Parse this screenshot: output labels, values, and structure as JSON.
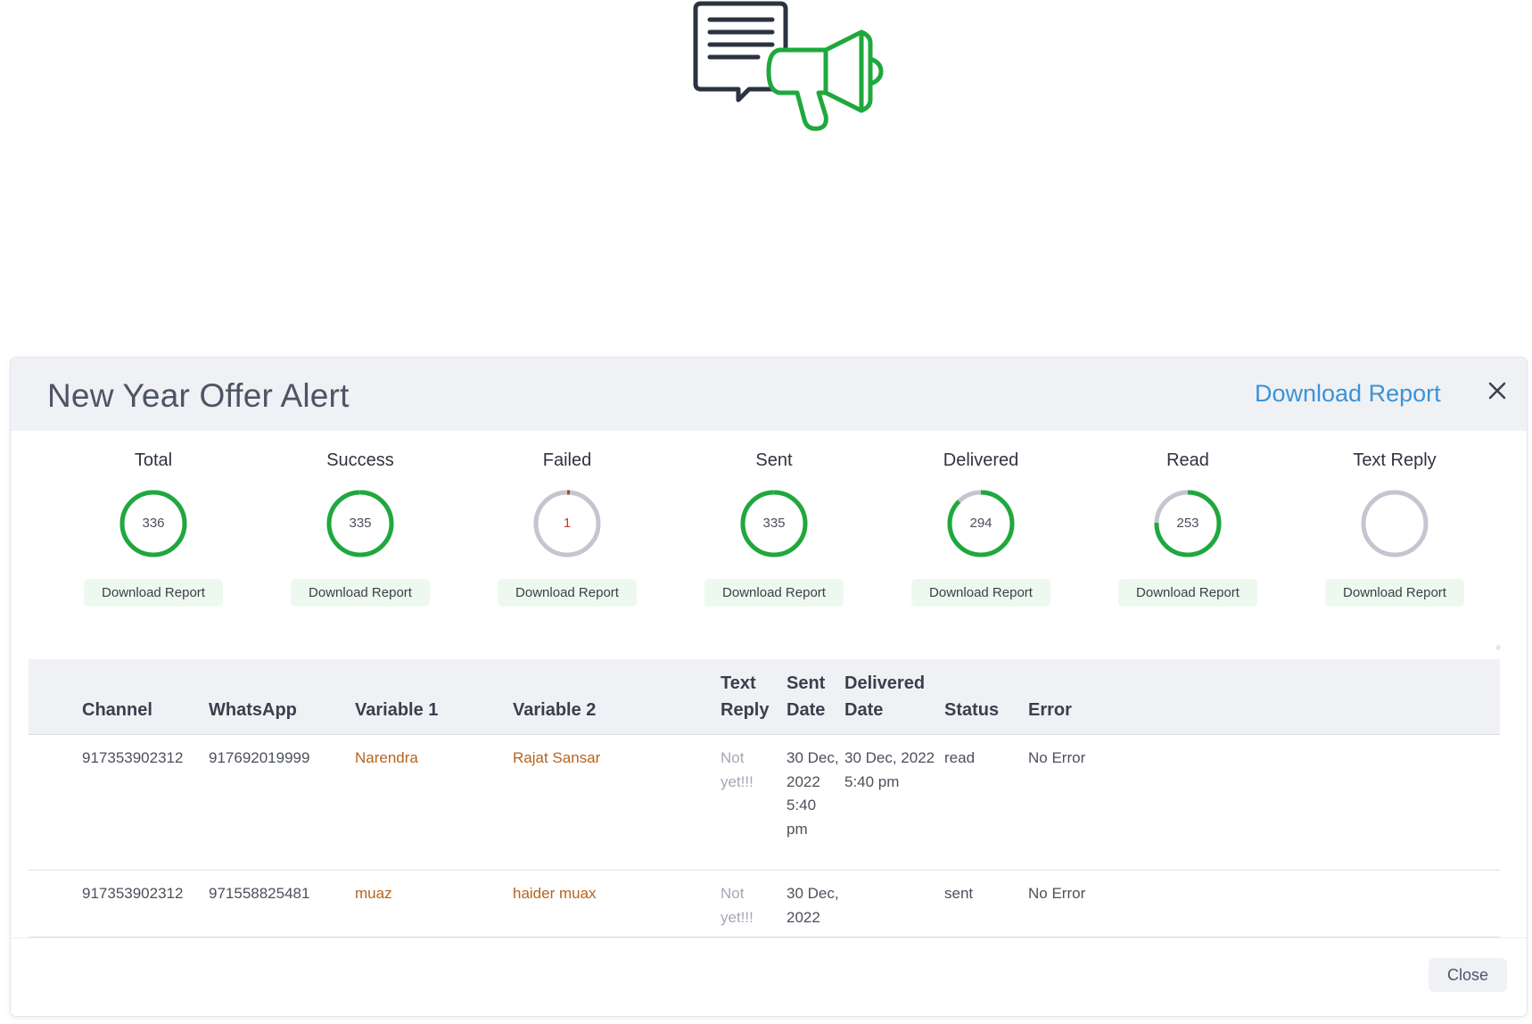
{
  "modal": {
    "title": "New Year Offer Alert",
    "download_report_label": "Download Report",
    "close_label": "Close"
  },
  "stats": [
    {
      "label": "Total",
      "value": "336",
      "fraction": 1.0,
      "color": "#1fa83d",
      "button": "Download Report"
    },
    {
      "label": "Success",
      "value": "335",
      "fraction": 0.997,
      "color": "#1fa83d",
      "button": "Download Report"
    },
    {
      "label": "Failed",
      "value": "1",
      "fraction": 0.003,
      "color": "#c0392b",
      "button": "Download Report"
    },
    {
      "label": "Sent",
      "value": "335",
      "fraction": 0.997,
      "color": "#1fa83d",
      "button": "Download Report"
    },
    {
      "label": "Delivered",
      "value": "294",
      "fraction": 0.875,
      "color": "#1fa83d",
      "button": "Download Report"
    },
    {
      "label": "Read",
      "value": "253",
      "fraction": 0.753,
      "color": "#1fa83d",
      "button": "Download Report"
    },
    {
      "label": "Text Reply",
      "value": "",
      "fraction": 0,
      "color": "#1fa83d",
      "button": "Download Report"
    }
  ],
  "colors": {
    "ring_track": "#c3c6d0",
    "accent_link": "#3b93d8",
    "variable_text": "#b5641f",
    "icon_dark": "#2b3240",
    "icon_green": "#1fa83d"
  },
  "icons": {
    "hero": "chat-megaphone-icon",
    "close": "close-icon"
  },
  "table": {
    "headers": {
      "channel": "Channel",
      "whatsapp": "WhatsApp",
      "variable1": "Variable 1",
      "variable2": "Variable 2",
      "text_reply": "Text Reply",
      "sent_date": "Sent Date",
      "delivered_date": "Delivered Date",
      "status": "Status",
      "error": "Error"
    },
    "rows": [
      {
        "channel": "917353902312",
        "whatsapp": "917692019999",
        "variable1": "Narendra",
        "variable2": "Rajat Sansar",
        "text_reply": "Not yet!!!",
        "sent_date": "30 Dec, 2022 5:40 pm",
        "delivered_date": "30 Dec, 2022 5:40 pm",
        "status": "read",
        "error": "No Error"
      },
      {
        "channel": "917353902312",
        "whatsapp": "971558825481",
        "variable1": "muaz",
        "variable2": "haider muax",
        "text_reply": "Not yet!!!",
        "sent_date": "30 Dec, 2022",
        "delivered_date": "",
        "status": "sent",
        "error": "No Error"
      }
    ]
  }
}
